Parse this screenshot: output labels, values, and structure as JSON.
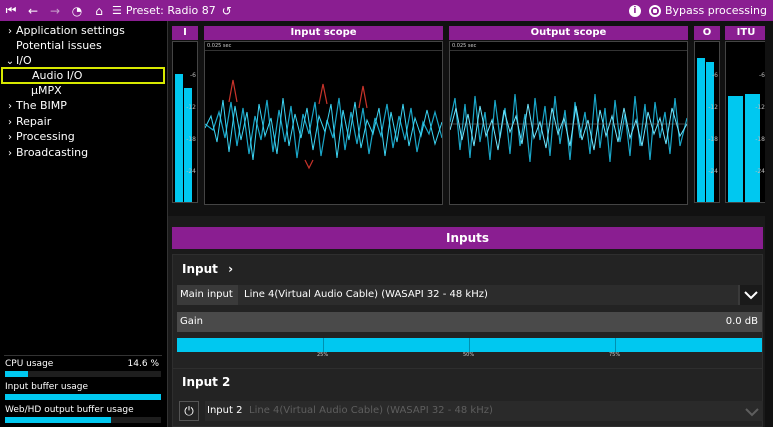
{
  "toolbar": {
    "preset_label": "Preset: Radio 87",
    "bypass_label": "Bypass processing"
  },
  "sidebar": {
    "items": [
      {
        "label": "Application settings",
        "chevron": "›"
      },
      {
        "label": "Potential issues",
        "chevron": ""
      },
      {
        "label": "I/O",
        "chevron": "⌄"
      },
      {
        "label": "Audio I/O",
        "chevron": ""
      },
      {
        "label": "µMPX",
        "chevron": ""
      },
      {
        "label": "The BIMP",
        "chevron": "›"
      },
      {
        "label": "Repair",
        "chevron": "›"
      },
      {
        "label": "Processing",
        "chevron": "›"
      },
      {
        "label": "Broadcasting",
        "chevron": "›"
      }
    ],
    "usage": {
      "cpu_label": "CPU usage",
      "cpu_value": "14.6 %",
      "cpu_fraction": 0.146,
      "input_buffer_label": "Input buffer usage",
      "input_buffer_fraction": 1.0,
      "output_buffer_label": "Web/HD output buffer usage",
      "output_buffer_fraction": 0.68
    }
  },
  "scopes": {
    "meter_i_label": "I",
    "input_scope_label": "Input scope",
    "output_scope_label": "Output scope",
    "meter_o_label": "O",
    "meter_itu_label": "ITU",
    "input_time": "0.025 sec",
    "output_time": "0.025 sec",
    "ticks": [
      "-6",
      "-12",
      "-18",
      "-24"
    ]
  },
  "inputs": {
    "header": "Inputs",
    "input1": {
      "title": "Input",
      "chevron": "›",
      "main_input_label": "Main input",
      "main_input_value": "Line 4(Virtual Audio Cable) (WASAPI 32 - 48 kHz)",
      "gain_label": "Gain",
      "gain_value": "0.0 dB",
      "gain_ticks": [
        "25%",
        "50%",
        "75%"
      ]
    },
    "input2": {
      "title": "Input 2",
      "label": "Input 2",
      "value": "Line 4(Virtual Audio Cable) (WASAPI 32 - 48 kHz)"
    }
  },
  "colors": {
    "accent": "#8a1e91",
    "meter": "#00c8f0",
    "selection": "#d7e800"
  }
}
